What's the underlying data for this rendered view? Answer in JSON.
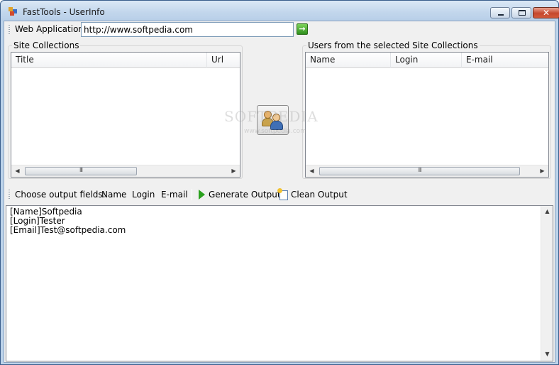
{
  "window": {
    "title": "FastTools - UserInfo",
    "controls": {
      "minimize": "–",
      "maximize": "□",
      "close": "✕"
    }
  },
  "toolbar1": {
    "label": "Web Application",
    "url_value": "http://www.softpedia.com",
    "go_icon": "→"
  },
  "site_collections": {
    "title": "Site Collections",
    "columns": [
      "Title",
      "Url"
    ],
    "scroll_grip": "III"
  },
  "users": {
    "title": "Users from the selected Site Collections",
    "columns": [
      "Name",
      "Login",
      "E-mail"
    ],
    "scroll_grip": "III"
  },
  "transfer_button": {
    "icon": "users-icon"
  },
  "toolbar2": {
    "label": "Choose output fields:",
    "fields": [
      "Name",
      "Login",
      "E-mail"
    ],
    "generate_label": "Generate Output",
    "clean_label": "Clean Output"
  },
  "output": {
    "lines": [
      "[Name]Softpedia",
      "[Login]Tester",
      "[Email]Test@softpedia.com"
    ]
  },
  "watermark": {
    "text": "SOFTPEDIA",
    "sub": "www.softpedia.com"
  },
  "scroll_glyphs": {
    "left": "◀",
    "right": "▶",
    "up": "▲",
    "down": "▼"
  },
  "colors": {
    "accent_go": "#2f8f1d",
    "play": "#2aa11e",
    "close_btn": "#c5472d"
  }
}
